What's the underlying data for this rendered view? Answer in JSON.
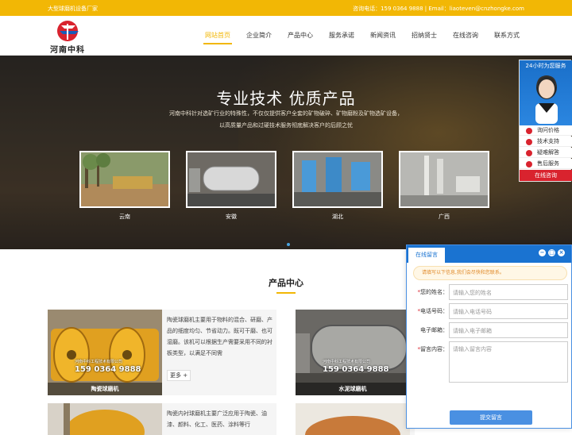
{
  "topbar": {
    "slogan": "大型球磨机设备厂家",
    "contact": "咨询电话：159 0364 9888 | Email：liaoteven@cnzhongke.com"
  },
  "header": {
    "logo_text": "河南中科",
    "nav": [
      "网站首页",
      "企业简介",
      "产品中心",
      "服务承诺",
      "新闻资讯",
      "招纳贤士",
      "在线咨询",
      "联系方式"
    ],
    "active_index": 0
  },
  "hero": {
    "title": "专业技术 优质产品",
    "desc_line1": "河南中科针对选矿行业的特殊性，不仅仅提供客户全套的矿物破碎、矿物磨粉及矿物选矿设备，",
    "desc_line2": "以高质量产品和过硬技术服务彻底解决客户的后顾之忧",
    "cases": [
      {
        "label": "云南"
      },
      {
        "label": "安徽"
      },
      {
        "label": "湖北"
      },
      {
        "label": "广西"
      }
    ]
  },
  "products": {
    "title": "产品中心",
    "watermark_company": "河南中科工程技术有限公司",
    "watermark_phone": "159 0364 9888",
    "more_label": "更多 +",
    "items": [
      {
        "name": "陶瓷球磨机",
        "desc": "陶瓷球磨机主要用于物料的混合、研磨、产品的细度均匀、节省动力。既可干磨、也可湿磨。该机可以根据生产需要采用不同的衬板类型，以满足不同需"
      },
      {
        "name": "水泥球磨机",
        "desc": ""
      },
      {
        "name": "",
        "desc": "陶瓷内衬球磨机主要广泛应用于陶瓷、油漆、颜料、化工、医药、涂料等行"
      },
      {
        "name": "",
        "desc": ""
      }
    ]
  },
  "float_panel": {
    "header": "24小时为您服务",
    "items": [
      "询问价格",
      "技术支持",
      "疑难解答",
      "售后服务"
    ],
    "online": "在线咨询"
  },
  "message": {
    "tab": "在线留言",
    "notice": "请填写以下信息,我们会尽快和您联系。",
    "fields": [
      {
        "label": "您的姓名：",
        "placeholder": "请输入您的姓名",
        "required": true
      },
      {
        "label": "电话号码：",
        "placeholder": "请输入电话号码",
        "required": true
      },
      {
        "label": "电子邮箱：",
        "placeholder": "请输入电子邮箱",
        "required": false
      },
      {
        "label": "留言内容：",
        "placeholder": "请输入留言内容",
        "required": true
      }
    ],
    "submit": "提交留言"
  },
  "colors": {
    "accent": "#f2b705",
    "brand_red": "#d9232e",
    "chat_blue": "#1a73d1"
  }
}
